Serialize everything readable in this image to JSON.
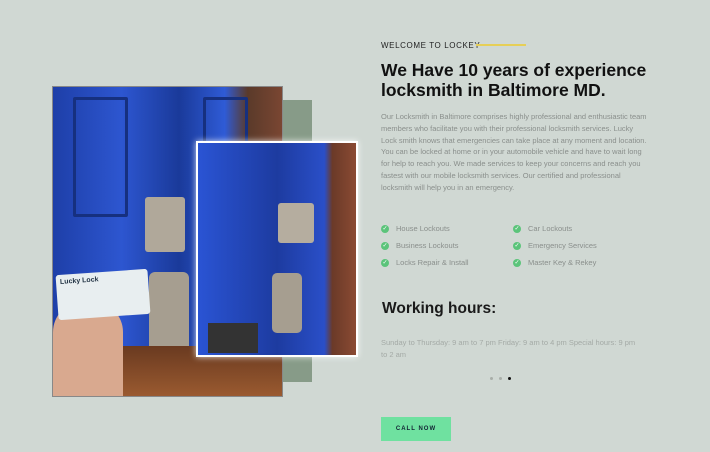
{
  "about": {
    "eyebrow": "WELCOME TO LOCKEY",
    "title": "We Have 10 years of experience locksmith in Baltimore MD.",
    "description": "Our Locksmith in Baltimore comprises highly professional and enthusiastic team members who facilitate you with their professional locksmith services. Lucky Lock smith knows that emergencies can take place at any moment and location. You can be locked at home or in your automobile vehicle and have to wait long for help to reach you. We made services to keep your concerns and reach you fastest with our mobile locksmith services. Our certified and professional locksmith will help you in an emergency.",
    "features": [
      "House Lockouts",
      "Car Lockouts",
      "Business Lockouts",
      "Emergency Services",
      "Locks Repair & Install",
      "Master Key & Rekey"
    ]
  },
  "hours": {
    "title": "Working hours:",
    "text": "Sunday to Thursday: 9 am to 7 pm Friday: 9 am to 4 pm Special hours: 9 pm to 2 am"
  },
  "carousel": {
    "count": 3,
    "active": 3
  },
  "cta": {
    "label": "CALL NOW"
  },
  "photo_card_text": "Lucky Lock",
  "colors": {
    "background": "#d0d8d3",
    "accent_line": "#e6cf57",
    "check": "#5bc47a",
    "cta": "#6fe1a0",
    "accent_block": "#879b88"
  }
}
